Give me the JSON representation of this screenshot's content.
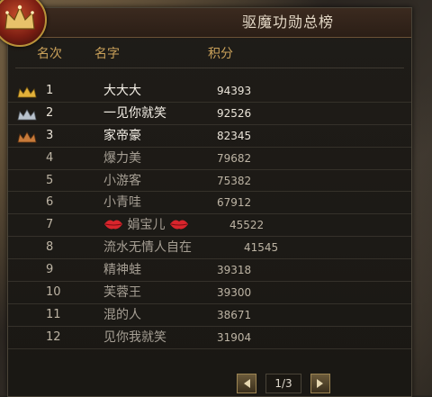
{
  "panel": {
    "title": "驱魔功勋总榜",
    "columns": {
      "rank": "名次",
      "name": "名字",
      "score": "积分"
    }
  },
  "rows": [
    {
      "rank": "1",
      "name": "大大大",
      "score": "94393",
      "medal": "gold"
    },
    {
      "rank": "2",
      "name": "一见你就笑",
      "score": "92526",
      "medal": "silver"
    },
    {
      "rank": "3",
      "name": "家帝豪",
      "score": "82345",
      "medal": "bronze"
    },
    {
      "rank": "4",
      "name": "爆力美",
      "score": "79682"
    },
    {
      "rank": "5",
      "name": "小游客",
      "score": "75382"
    },
    {
      "rank": "6",
      "name": "小青哇",
      "score": "67912"
    },
    {
      "rank": "7",
      "name": "娟宝儿",
      "score": "45522",
      "decor": "lips-icon"
    },
    {
      "rank": "8",
      "name": "流水无情人自在",
      "score": "41545"
    },
    {
      "rank": "9",
      "name": "精神蛙",
      "score": "39318"
    },
    {
      "rank": "10",
      "name": "芙蓉王",
      "score": "39300"
    },
    {
      "rank": "11",
      "name": "混的人",
      "score": "38671"
    },
    {
      "rank": "12",
      "name": "见你我就笑",
      "score": "31904"
    }
  ],
  "pager": {
    "label": "1/3"
  },
  "colors": {
    "gold": "#e2b13a",
    "silver": "#b9c2cc",
    "bronze": "#c77a3a",
    "header": "#c9a15a"
  }
}
